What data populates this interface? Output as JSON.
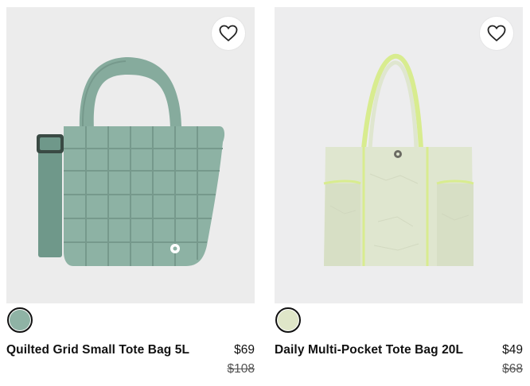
{
  "products": [
    {
      "name": "Quilted Grid Small Tote Bag 5L",
      "price": "$69",
      "original_price": "$108",
      "swatch_color": "#8fb3a5",
      "image_alt": "",
      "favorite_icon": "heart-outline-icon"
    },
    {
      "name": "Daily Multi-Pocket Tote Bag 20L",
      "price": "$49",
      "original_price": "$68",
      "swatch_color": "#dfe6c8",
      "image_alt": "",
      "favorite_icon": "heart-outline-icon"
    }
  ],
  "colors": {
    "sage_green": "#7fa596",
    "light_green": "#dfe6cf",
    "piping": "#d8ec8f"
  }
}
